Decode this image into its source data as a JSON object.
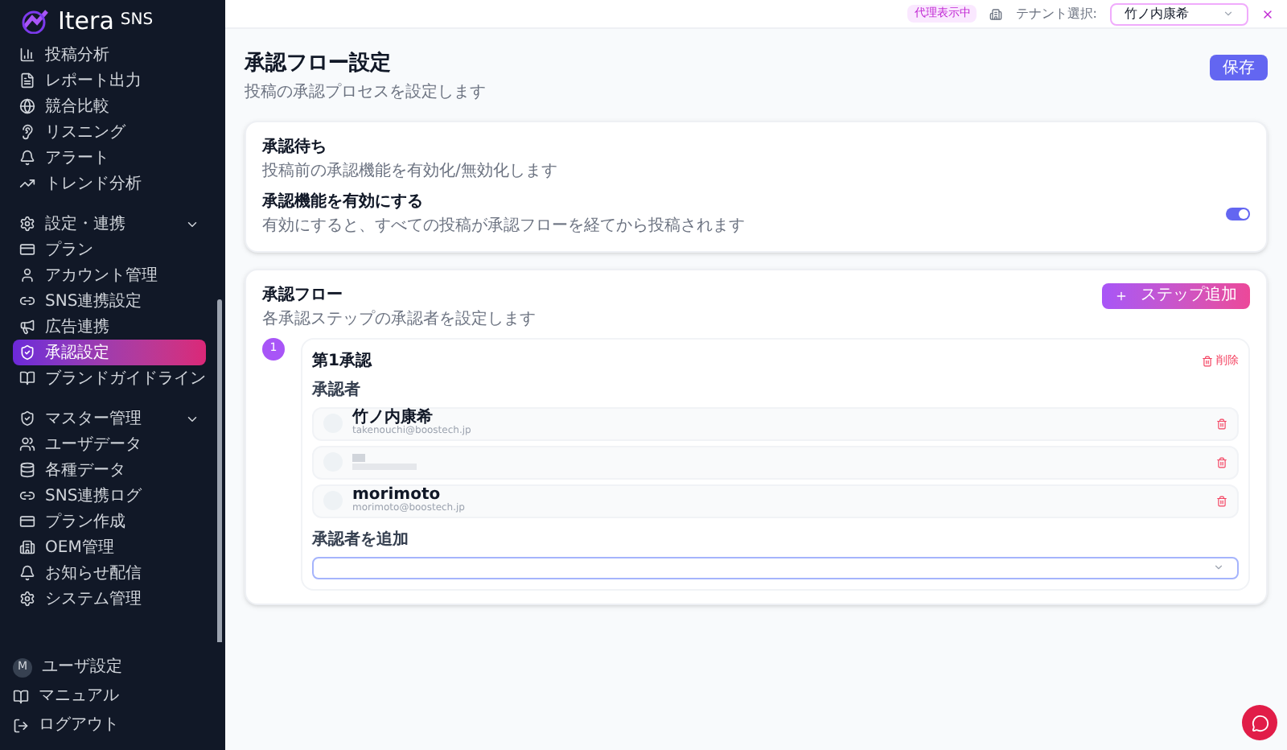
{
  "logo": {
    "text": "Itera",
    "suffix": "SNS"
  },
  "sidebar": {
    "sections": [
      {
        "items": [
          {
            "label": "投稿分析",
            "selected": false
          },
          {
            "label": "レポート出力",
            "selected": false
          },
          {
            "label": "競合比較",
            "selected": false
          },
          {
            "label": "リスニング",
            "selected": false
          },
          {
            "label": "アラート",
            "selected": false
          },
          {
            "label": "トレンド分析",
            "selected": false
          }
        ]
      },
      {
        "header": {
          "label": "設定・連携",
          "expanded": true
        },
        "items": [
          {
            "label": "プラン",
            "selected": false
          },
          {
            "label": "アカウント管理",
            "selected": false
          },
          {
            "label": "SNS連携設定",
            "selected": false
          },
          {
            "label": "広告連携",
            "selected": false
          },
          {
            "label": "承認設定",
            "selected": true
          },
          {
            "label": "ブランドガイドライン",
            "selected": false
          }
        ]
      },
      {
        "header": {
          "label": "マスター管理",
          "expanded": true
        },
        "items": [
          {
            "label": "ユーザデータ",
            "selected": false
          },
          {
            "label": "各種データ",
            "selected": false
          },
          {
            "label": "SNS連携ログ",
            "selected": false
          },
          {
            "label": "プラン作成",
            "selected": false
          },
          {
            "label": "OEM管理",
            "selected": false
          },
          {
            "label": "お知らせ配信",
            "selected": false
          },
          {
            "label": "システム管理",
            "selected": false
          }
        ]
      }
    ],
    "footer": [
      {
        "kind": "avatar",
        "initial": "M",
        "label": "ユーザ設定"
      },
      {
        "kind": "icon",
        "label": "マニュアル"
      },
      {
        "kind": "icon",
        "label": "ログアウト"
      }
    ]
  },
  "topbar": {
    "badge": "代理表示中",
    "tenant_label": "テナント選択:",
    "tenant_value": "竹ノ内康希"
  },
  "page": {
    "title": "承認フロー設定",
    "subtitle": "投稿の承認プロセスを設定します",
    "save_button": "保存"
  },
  "approval_wait": {
    "title": "承認待ち",
    "description": "投稿前の承認機能を有効化/無効化します",
    "toggle_label": "承認機能を有効にする",
    "toggle_hint": "有効にすると、すべての投稿が承認フローを経てから投稿されます",
    "on": true
  },
  "approval_flow": {
    "title": "承認フロー",
    "description": "各承認ステップの承認者を設定します",
    "add_button": "ステップ追加",
    "steps": [
      {
        "number": "1",
        "title": "第1承認",
        "delete": "削除",
        "approvers_label": "承認者",
        "approvers": [
          {
            "kind": "named",
            "name": "竹ノ内康希",
            "email": "takenouchi@boostech.jp"
          },
          {
            "kind": "redacted"
          },
          {
            "kind": "named",
            "name": "morimoto",
            "email": "morimoto@boostech.jp"
          }
        ],
        "add_label": "承認者を追加"
      }
    ]
  }
}
